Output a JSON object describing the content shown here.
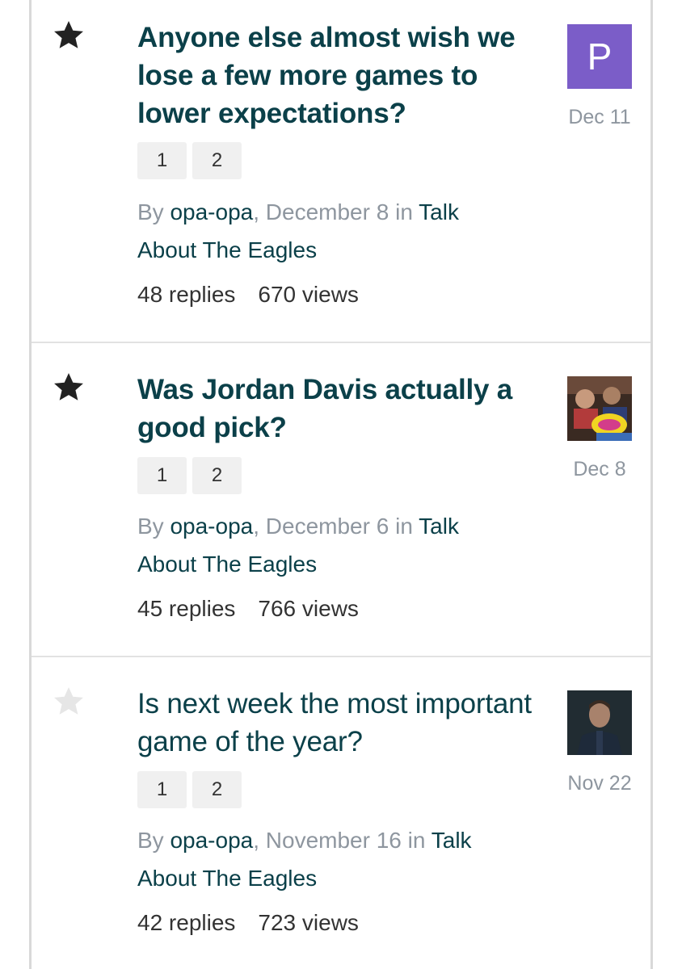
{
  "topics": [
    {
      "starred": true,
      "title": "Anyone else almost wish we lose a few more games to lower expectations?",
      "pages": [
        "1",
        "2"
      ],
      "by_label": "By",
      "author": "opa-opa",
      "posted": "December 8",
      "in_label": "in",
      "forum": "Talk About The Eagles",
      "replies": "48 replies",
      "views": "670 views",
      "avatar_letter": "P",
      "last_date": "Dec 11"
    },
    {
      "starred": true,
      "title": "Was Jordan Davis actually a good pick?",
      "pages": [
        "1",
        "2"
      ],
      "by_label": "By",
      "author": "opa-opa",
      "posted": "December 6",
      "in_label": "in",
      "forum": "Talk About The Eagles",
      "replies": "45 replies",
      "views": "766 views",
      "last_date": "Dec 8"
    },
    {
      "starred": false,
      "title": "Is next week the most important game of the year?",
      "pages": [
        "1",
        "2"
      ],
      "by_label": "By",
      "author": "opa-opa",
      "posted": "November 16",
      "in_label": "in",
      "forum": "Talk About The Eagles",
      "replies": "42 replies",
      "views": "723 views",
      "last_date": "Nov 22"
    }
  ],
  "colors": {
    "title": "#0b4049",
    "muted": "#8e969f",
    "star_active": "#222222",
    "star_inactive": "#e6e6e6",
    "avatar_purple": "#7b5dc8"
  }
}
